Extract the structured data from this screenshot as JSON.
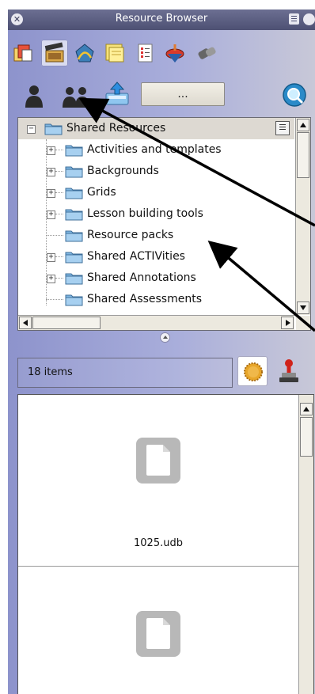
{
  "window": {
    "title": "Resource Browser"
  },
  "toolbar": {
    "tools": [
      {
        "name": "cards-icon",
        "active": false
      },
      {
        "name": "clapperboard-icon",
        "active": true
      },
      {
        "name": "vector-shapes-icon",
        "active": false
      },
      {
        "name": "sticky-notes-icon",
        "active": false
      },
      {
        "name": "checklist-icon",
        "active": false
      },
      {
        "name": "spinning-top-icon",
        "active": false
      },
      {
        "name": "eraser-tools-icon",
        "active": false
      }
    ]
  },
  "actions": {
    "ellipsis_label": "...",
    "icons": [
      "single-user-icon",
      "group-users-icon",
      "upload-tray-icon",
      "search-magnifier-icon"
    ]
  },
  "tree": {
    "root": "Shared Resources",
    "items": [
      {
        "label": "Activities and templates",
        "expandable": true
      },
      {
        "label": "Backgrounds",
        "expandable": true
      },
      {
        "label": "Grids",
        "expandable": true
      },
      {
        "label": "Lesson building tools",
        "expandable": true
      },
      {
        "label": "Resource packs",
        "expandable": false
      },
      {
        "label": "Shared ACTIVities",
        "expandable": true
      },
      {
        "label": "Shared Annotations",
        "expandable": true
      },
      {
        "label": "Shared Assessments",
        "expandable": false
      }
    ]
  },
  "status": {
    "count_text": "18 items"
  },
  "files": [
    {
      "name": "1025.udb"
    },
    {
      "name": ""
    }
  ],
  "colors": {
    "panel": "#9ea3d5",
    "titlebar": "#5a5d80",
    "folder": "#8fc3ea",
    "arrow": "#000000"
  }
}
